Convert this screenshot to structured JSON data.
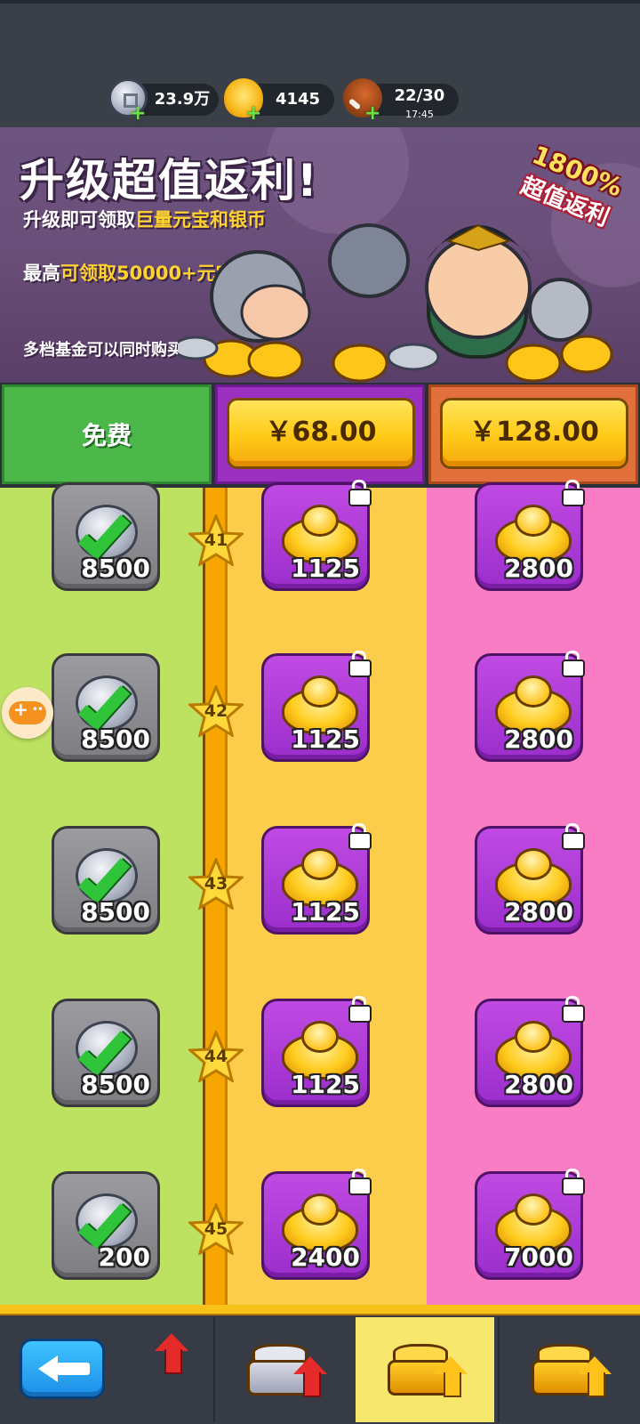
{
  "resources": {
    "silver": {
      "value": "23.9万",
      "icon": "silver-coin-icon"
    },
    "gold": {
      "value": "4145",
      "icon": "gold-ingot-icon"
    },
    "stamina": {
      "value": "22/30",
      "timer": "17:45",
      "icon": "meat-icon"
    }
  },
  "banner": {
    "title": "升级超值返利!",
    "line1_prefix": "升级即可领取",
    "line1_highlight": "巨量元宝和银币",
    "line2_prefix": "最高",
    "line2_highlight": "可领取50000+元宝",
    "line3": "多档基金可以同时购买",
    "badge_percent": "1800%",
    "badge_text": "超值返利"
  },
  "tiers": {
    "free_label": "免费",
    "tier2_price": "￥68.00",
    "tier3_price": "￥128.00"
  },
  "rows": [
    {
      "level": "41",
      "free": "8500",
      "tier2": "1125",
      "tier3": "2800"
    },
    {
      "level": "42",
      "free": "8500",
      "tier2": "1125",
      "tier3": "2800"
    },
    {
      "level": "43",
      "free": "8500",
      "tier2": "1125",
      "tier3": "2800"
    },
    {
      "level": "44",
      "free": "8500",
      "tier2": "1125",
      "tier3": "2800"
    },
    {
      "level": "45",
      "free": "200",
      "tier2": "2400",
      "tier3": "7000"
    }
  ],
  "colors": {
    "free_column": "#bde262",
    "tier2_column": "#fccd4a",
    "tier3_column": "#f97dc4",
    "buy_button": "#ffc917"
  }
}
